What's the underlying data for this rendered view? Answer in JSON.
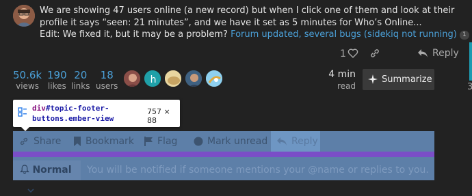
{
  "post": {
    "text": "We are showing 47 users online (a new record) but when I click one of them and look at their profile it says “seen: 21 minutes”, and we have it set as 5 minutes for Who’s Online...",
    "edit_prefix": "Edit: We fixed it, but it may be a problem?",
    "edit_link": "Forum updated, several bugs (sidekiq not running)",
    "edit_link_count": "1",
    "like_count": "1",
    "reply_label": "Reply"
  },
  "edge_number": "3",
  "stats": [
    {
      "value": "50.6k",
      "label": "views"
    },
    {
      "value": "190",
      "label": "likes"
    },
    {
      "value": "20",
      "label": "links"
    },
    {
      "value": "18",
      "label": "users"
    }
  ],
  "participants": {
    "letter_avatar": "h"
  },
  "read_time": {
    "value": "4 min",
    "label": "read"
  },
  "summarize_label": "Summarize",
  "inspector": {
    "selector_tag": "div",
    "selector_rest": "#topic-footer-buttons",
    "selector_class": ".ember-view",
    "dimensions": "757 × 88"
  },
  "footer_buttons": {
    "share": "Share",
    "bookmark": "Bookmark",
    "flag": "Flag",
    "mark_unread": "Mark unread",
    "reply": "Reply"
  },
  "notifications": {
    "level": "Normal",
    "description": "You will be notified if someone mentions your @name or replies to you."
  },
  "colors": {
    "background": "#222222",
    "link": "#4ba0d8",
    "highlight": "#5d7fa8",
    "highlight_padding": "#7a4ec7"
  }
}
